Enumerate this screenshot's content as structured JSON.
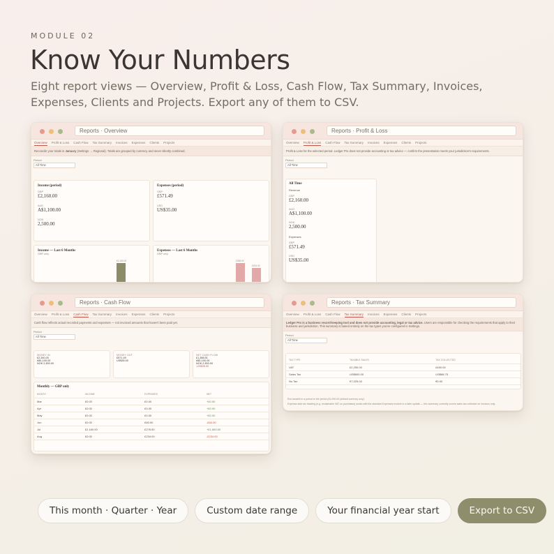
{
  "header": {
    "module": "MODULE 02",
    "title": "Know Your Numbers",
    "subtitle": "Eight report views — Overview, Profit & Loss, Cash Flow, Tax Summary, Invoices, Expenses, Clients and Projects. Export any of them to CSV."
  },
  "tabs": [
    "Overview",
    "Profit & Loss",
    "Cash Flow",
    "Tax Summary",
    "Invoices",
    "Expenses",
    "Clients",
    "Projects"
  ],
  "overview": {
    "window_title": "Reports · Overview",
    "notice_prefix": "Reconcile your totals in ",
    "notice_bold": "January",
    "notice_suffix": " (Settings → Regional). Totals are grouped by currency and never silently combined.",
    "period_label": "Period",
    "period_value": "All Time",
    "income_title": "Income (period)",
    "income": [
      {
        "cur": "GBP",
        "amt": "£2,160.00"
      },
      {
        "cur": "AUD",
        "amt": "A$1,100.00"
      },
      {
        "cur": "NOK",
        "amt": "2,500.00"
      }
    ],
    "expenses_title": "Expenses (period)",
    "expenses": [
      {
        "cur": "GBP",
        "amt": "£571.49"
      },
      {
        "cur": "USD",
        "amt": "US$35.00"
      }
    ],
    "income_chart_title": "Income — Last 6 Months",
    "income_chart_sub": "GBP only",
    "income_bar_label": "£2,160.00",
    "expenses_chart_title": "Expenses — Last 6 Months",
    "expenses_chart_sub": "GBP only",
    "expenses_bar1_label": "£338.00",
    "expenses_bar2_label": "£234.00"
  },
  "pnl": {
    "window_title": "Reports · Profit & Loss",
    "notice": "Profit & Loss for the selected period. Ledger Pro does not provide accounting or tax advice — confirm the presentation meets your jurisdiction's requirements.",
    "period_label": "Period",
    "period_value": "All Time",
    "card_title": "All Time",
    "revenue_label": "Revenue",
    "revenue": [
      {
        "cur": "GBP",
        "amt": "£2,160.00"
      },
      {
        "cur": "AUD",
        "amt": "A$1,100.00"
      },
      {
        "cur": "NOK",
        "amt": "2,500.00"
      }
    ],
    "expenses_label": "Expenses",
    "expenses": [
      {
        "cur": "GBP",
        "amt": "£571.49"
      },
      {
        "cur": "USD",
        "amt": "US$35.00"
      }
    ]
  },
  "cashflow": {
    "window_title": "Reports · Cash Flow",
    "notice": "Cash flow reflects actual recorded payments and expenses — not invoiced amounts that haven't been paid yet.",
    "period_label": "Period",
    "period_value": "All Time",
    "money_in_label": "MONEY IN",
    "money_in": [
      "£2,340.00",
      "A$1,100.00",
      "NOK 2,500.00"
    ],
    "money_out_label": "MONEY OUT",
    "money_out": [
      "£571.49",
      "US$35.00"
    ],
    "net_label": "NET CASH FLOW",
    "net": [
      "£1,388.51",
      "A$1,100.00",
      "NOK 2,500.00",
      "-US$35.00"
    ],
    "monthly_title": "Monthly — GBP only",
    "columns": [
      "MONTH",
      "INCOME",
      "EXPENSES",
      "NET"
    ],
    "rows": [
      {
        "m": "Mar",
        "i": "£0.00",
        "e": "£0.00",
        "n": "+£0.00"
      },
      {
        "m": "Apr",
        "i": "£0.00",
        "e": "£0.00",
        "n": "+£0.00"
      },
      {
        "m": "May",
        "i": "£0.00",
        "e": "£0.00",
        "n": "+£0.00"
      },
      {
        "m": "Jun",
        "i": "£0.00",
        "e": "£60.00",
        "n": "-£60.00"
      },
      {
        "m": "Jul",
        "i": "£2,160.00",
        "e": "£276.50",
        "n": "+£1,883.50"
      },
      {
        "m": "Aug",
        "i": "£0.00",
        "e": "£234.00",
        "n": "-£234.00"
      }
    ]
  },
  "tax": {
    "window_title": "Reports · Tax Summary",
    "notice_bold": "Ledger Pro is a business record-keeping tool and does not provide accounting, legal or tax advice.",
    "notice_rest": " Users are responsible for checking the requirements that apply to their business and jurisdiction. This summary is based entirely on the tax types you've configured in Settings.",
    "period_label": "Period",
    "period_value": "All Time",
    "columns": [
      "TAX TYPE",
      "TAXABLE SALES",
      "TAX COLLECTED"
    ],
    "rows": [
      {
        "t": "VAT",
        "s": "£2,250.00",
        "c": "£450.00"
      },
      {
        "t": "Sales Tax",
        "s": "US$600.00",
        "c": "US$68.75"
      },
      {
        "t": "No Tax",
        "s": "€7,025.00",
        "c": "€0.00"
      }
    ],
    "footnote1": "Run taxable in a period to the period (£1,090.00 (default currency only).",
    "footnote2": "Expense-side tax tracking (e.g. reclaimable VAT on purchases) works with the standard Expenses module in a later update — this summary currently covers sales tax collected on invoices only."
  },
  "chips": [
    "This month · Quarter · Year",
    "Custom date range",
    "Your financial year start",
    "Export to CSV"
  ],
  "colors": {
    "accent": "#8e8e6d",
    "income_bar": "#8c8c6a",
    "expense_bar": "#e3a8a8",
    "active_tab": "#c0584a"
  }
}
